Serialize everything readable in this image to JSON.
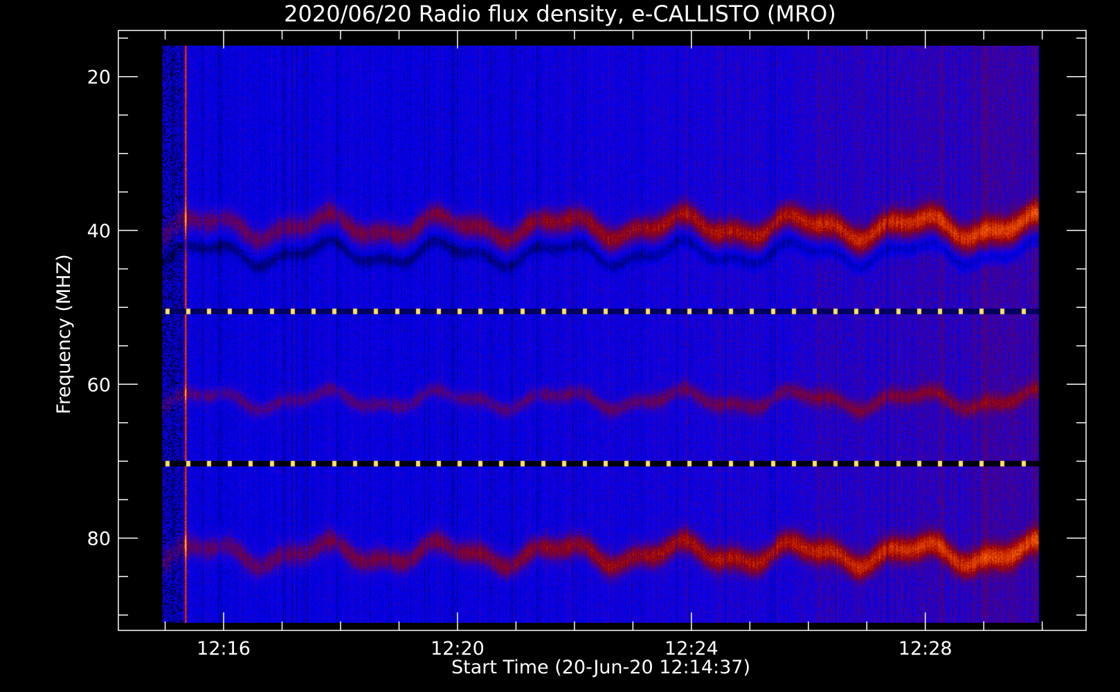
{
  "chart_data": {
    "type": "heatmap",
    "title": "2020/06/20  Radio flux density, e-CALLISTO (MRO)",
    "xlabel": "Start Time (20-Jun-20 12:14:37)",
    "ylabel": "Frequency (MHZ)",
    "x_tick_labels": [
      "12:16",
      "12:20",
      "12:24",
      "12:28"
    ],
    "x_tick_minutes": [
      16,
      20,
      24,
      28
    ],
    "x_range_minutes": [
      14.2,
      30.75
    ],
    "data_range_minutes": [
      14.95,
      29.95
    ],
    "y_tick_labels": [
      "20",
      "40",
      "60",
      "80"
    ],
    "y_tick_values": [
      20,
      40,
      60,
      80
    ],
    "y_range": [
      14,
      92
    ],
    "y_reversed": true,
    "data_freq_range": [
      16,
      91
    ],
    "grid": false,
    "colormap": [
      "#000000",
      "#0000ff",
      "#9b0000",
      "#ff6000",
      "#ffff80"
    ],
    "features": [
      {
        "kind": "broadband_burst",
        "time_minutes": 15.35
      },
      {
        "kind": "rfi_line",
        "freq_mhz": 50.5
      },
      {
        "kind": "rfi_line",
        "freq_mhz": 70.3
      },
      {
        "kind": "emission_band",
        "freq_mhz": 39.5
      },
      {
        "kind": "emission_band",
        "freq_mhz": 82
      }
    ]
  }
}
